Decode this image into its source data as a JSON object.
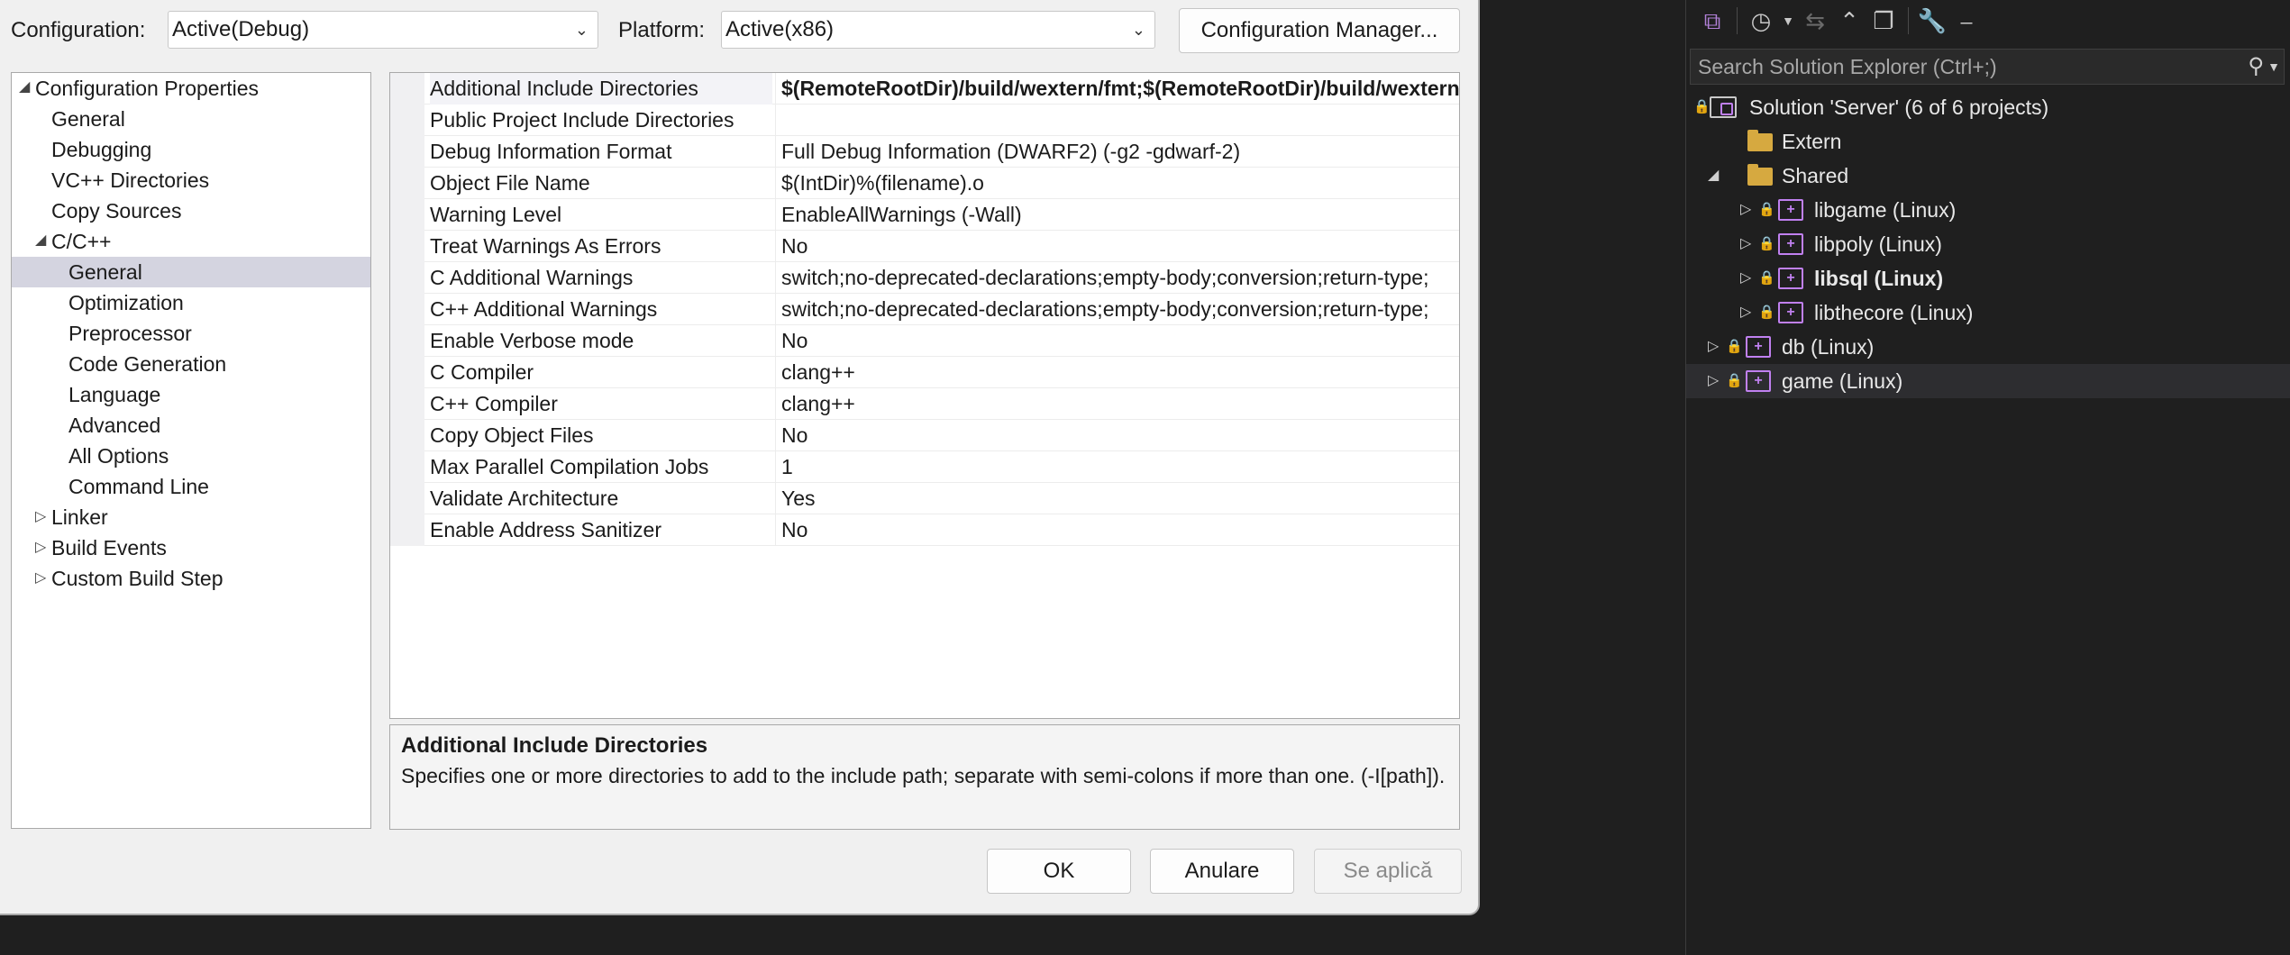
{
  "dialog": {
    "configuration_label": "Configuration:",
    "configuration_value": "Active(Debug)",
    "platform_label": "Platform:",
    "platform_value": "Active(x86)",
    "config_manager_button": "Configuration Manager...",
    "ok_button": "OK",
    "cancel_button": "Anulare",
    "apply_button": "Se aplică"
  },
  "tree": {
    "root": "Configuration Properties",
    "items": [
      "General",
      "Debugging",
      "VC++ Directories",
      "Copy Sources",
      "C/C++",
      "General",
      "Optimization",
      "Preprocessor",
      "Code Generation",
      "Language",
      "Advanced",
      "All Options",
      "Command Line",
      "Linker",
      "Build Events",
      "Custom Build Step"
    ]
  },
  "grid": {
    "rows": [
      {
        "name": "Additional Include Directories",
        "value": "$(RemoteRootDir)/build/wextern/fmt;$(RemoteRootDir)/build/wextern/spdlog;$(RemoteRootDir)/build"
      },
      {
        "name": "Public Project Include Directories",
        "value": ""
      },
      {
        "name": "Debug Information Format",
        "value": "Full Debug Information (DWARF2) (-g2 -gdwarf-2)"
      },
      {
        "name": "Object File Name",
        "value": "$(IntDir)%(filename).o"
      },
      {
        "name": "Warning Level",
        "value": "EnableAllWarnings (-Wall)"
      },
      {
        "name": "Treat Warnings As Errors",
        "value": "No"
      },
      {
        "name": "C Additional Warnings",
        "value": "switch;no-deprecated-declarations;empty-body;conversion;return-type;"
      },
      {
        "name": "C++ Additional Warnings",
        "value": "switch;no-deprecated-declarations;empty-body;conversion;return-type;"
      },
      {
        "name": "Enable Verbose mode",
        "value": "No"
      },
      {
        "name": "C Compiler",
        "value": "clang++"
      },
      {
        "name": "C++ Compiler",
        "value": "clang++"
      },
      {
        "name": "Copy Object Files",
        "value": "No"
      },
      {
        "name": "Max Parallel Compilation Jobs",
        "value": "1"
      },
      {
        "name": "Validate Architecture",
        "value": "Yes"
      },
      {
        "name": "Enable Address Sanitizer",
        "value": "No"
      }
    ]
  },
  "description": {
    "title": "Additional Include Directories",
    "text": "Specifies one or more directories to add to the include path; separate with semi-colons if more than one. (-I[path])."
  },
  "solution_explorer": {
    "search_placeholder": "Search Solution Explorer (Ctrl+;)",
    "solution": "Solution 'Server' (6 of 6 projects)",
    "extern": "Extern",
    "shared": "Shared",
    "libgame": "libgame (Linux)",
    "libpoly": "libpoly (Linux)",
    "libsql": "libsql (Linux)",
    "libthecore": "libthecore (Linux)",
    "db": "db (Linux)",
    "game": "game (Linux)"
  }
}
